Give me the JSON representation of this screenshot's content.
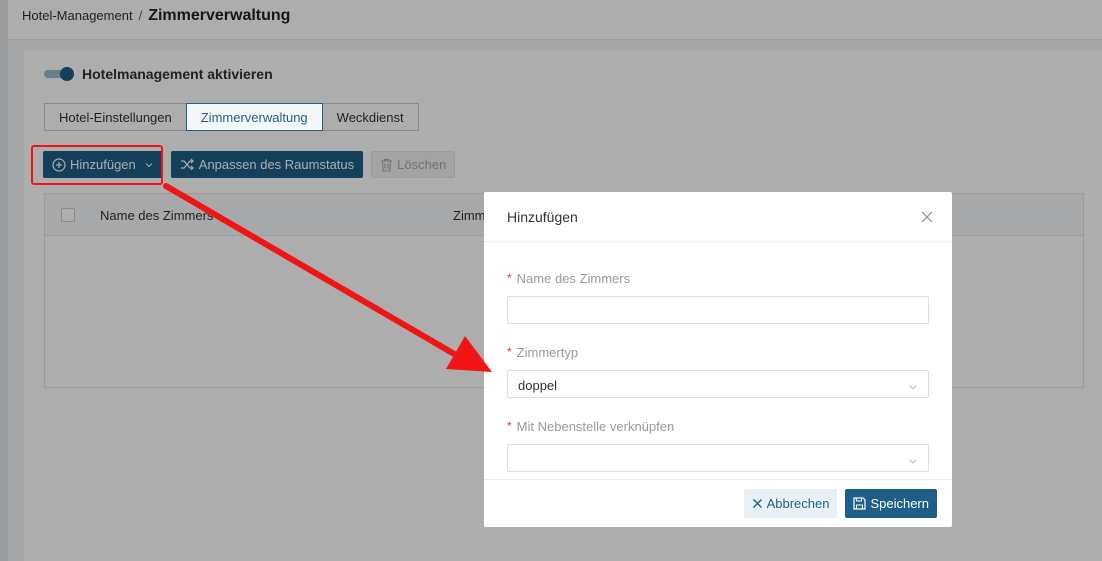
{
  "breadcrumb": {
    "root": "Hotel-Management",
    "separator": "/",
    "current": "Zimmerverwaltung"
  },
  "switch": {
    "label": "Hotelmanagement aktivieren",
    "on": true
  },
  "tabs": [
    {
      "label": "Hotel-Einstellungen",
      "active": false
    },
    {
      "label": "Zimmerverwaltung",
      "active": true
    },
    {
      "label": "Weckdienst",
      "active": false
    }
  ],
  "toolbar": {
    "add_label": "Hinzufügen",
    "adjust_label": "Anpassen des Raumstatus",
    "delete_label": "Löschen"
  },
  "table": {
    "columns": [
      "Name des Zimmers",
      "Zimm"
    ]
  },
  "modal": {
    "title": "Hinzufügen",
    "fields": {
      "room_name": {
        "label": "Name des Zimmers",
        "value": ""
      },
      "room_type": {
        "label": "Zimmertyp",
        "value": "doppel"
      },
      "extension": {
        "label": "Mit Nebenstelle verknüpfen",
        "value": ""
      }
    },
    "cancel_label": "Abbrechen",
    "save_label": "Speichern"
  },
  "colors": {
    "primary": "#1e5f87",
    "annotation": "#f01414"
  }
}
